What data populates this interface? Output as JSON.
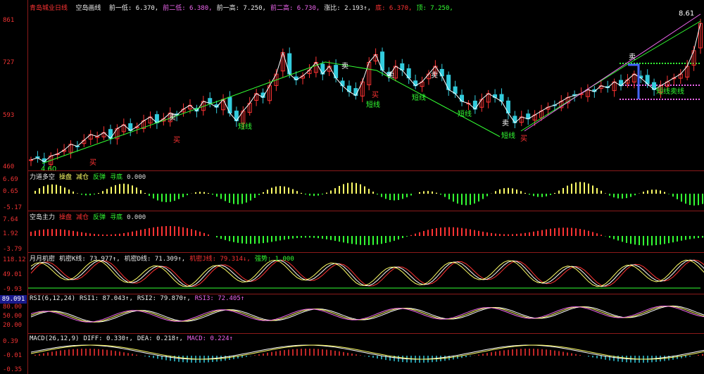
{
  "main": {
    "title": "青岛城业日线",
    "fields": [
      {
        "label": "空岛画线",
        "value": "",
        "color": "#eeeeee"
      },
      {
        "label": "前一低:",
        "value": "6.370,",
        "color": "#eeeeee"
      },
      {
        "label": "前二低:",
        "value": "6.380,",
        "color": "#ee66ee"
      },
      {
        "label": "前一高:",
        "value": "7.250,",
        "color": "#eeeeee"
      },
      {
        "label": "前二高:",
        "value": "6.730,",
        "color": "#ee66ee"
      },
      {
        "label": "涨比:",
        "value": "2.193↑,",
        "color": "#eeeeee"
      },
      {
        "label": "底:",
        "value": "6.370,",
        "color": "#ff3333"
      },
      {
        "label": "顶:",
        "value": "7.250,",
        "color": "#33ff33"
      }
    ],
    "yticks": [
      "861",
      "727",
      "593",
      "460"
    ],
    "marks": {
      "high_label": "8.61",
      "low_label": "4.60",
      "buy": "买",
      "sell": "卖",
      "short": "短线",
      "short_sell": "短线卖线"
    }
  },
  "panes": [
    {
      "title": "力道多空",
      "items": [
        {
          "t": "操盘",
          "c": "#ffff66"
        },
        {
          "t": "减仓",
          "c": "#ffff66"
        },
        {
          "t": "反弹",
          "c": "#33ff33"
        },
        {
          "t": "寻底",
          "c": "#33ff33"
        },
        {
          "t": "0.000",
          "c": "#dddddd"
        }
      ],
      "yticks": [
        "6.69",
        "0.65",
        "-5.17"
      ]
    },
    {
      "title": "空岛主力",
      "items": [
        {
          "t": "操盘",
          "c": "#ff3333"
        },
        {
          "t": "减仓",
          "c": "#ff3333"
        },
        {
          "t": "反弹",
          "c": "#33ff33"
        },
        {
          "t": "寻底",
          "c": "#33ff33"
        },
        {
          "t": "0.000",
          "c": "#dddddd"
        }
      ],
      "yticks": [
        "7.64",
        "1.92",
        "-3.79"
      ]
    },
    {
      "title": "月月机密",
      "items": [
        {
          "t": "机密K线: 73.977↑,",
          "c": "#eeeeee"
        },
        {
          "t": "机密D线: 71.309↑,",
          "c": "#eeeeee"
        },
        {
          "t": "机密J线: 79.314↓,",
          "c": "#ff3333"
        },
        {
          "t": "强势: 1.000",
          "c": "#33ff33"
        }
      ],
      "yticks": [
        "118.12",
        "49.01",
        "-9.93"
      ]
    },
    {
      "title": "RSI(6,12,24)",
      "items": [
        {
          "t": "RSI1: 87.043↑,",
          "c": "#eeeeee"
        },
        {
          "t": "RSI2: 79.870↑,",
          "c": "#eeeeee"
        },
        {
          "t": "RSI3: 72.405↑",
          "c": "#ee66ee"
        }
      ],
      "yticks": [
        "80.00",
        "50.00",
        "20.00"
      ],
      "cursor": "89.091"
    },
    {
      "title": "MACD(26,12,9)",
      "items": [
        {
          "t": "DIFF: 0.330↑,",
          "c": "#eeeeee"
        },
        {
          "t": "DEA: 0.218↑,",
          "c": "#eeeeee"
        },
        {
          "t": "MACD: 0.224↑",
          "c": "#ee66ee"
        }
      ],
      "yticks": [
        "0.39",
        "-0.01",
        "-0.35"
      ]
    }
  ],
  "colors": {
    "up": "#ff3333",
    "down": "#33ccdd",
    "grid": "#8b1a1a",
    "yellow": "#ffff66",
    "green": "#33ff33",
    "pink": "#ee66ee"
  },
  "chart_data": {
    "type": "candlestick",
    "y_range": [
      4.6,
      8.61
    ],
    "close_series": [
      4.8,
      4.85,
      4.75,
      4.9,
      4.95,
      5.05,
      5.2,
      5.15,
      5.3,
      5.45,
      5.4,
      5.5,
      5.35,
      5.6,
      5.7,
      5.55,
      5.65,
      5.8,
      5.9,
      5.75,
      5.85,
      6.0,
      5.95,
      6.1,
      6.2,
      6.05,
      6.3,
      6.25,
      6.15,
      6.35,
      6.0,
      5.8,
      6.05,
      6.25,
      6.5,
      6.4,
      6.7,
      7.0,
      7.55,
      7.0,
      6.85,
      6.95,
      7.1,
      7.3,
      7.0,
      7.2,
      6.9,
      6.7,
      6.55,
      6.45,
      6.8,
      7.3,
      7.5,
      7.1,
      6.95,
      7.2,
      7.1,
      6.9,
      6.7,
      6.8,
      7.0,
      7.2,
      6.95,
      6.6,
      6.5,
      6.3,
      6.25,
      6.1,
      6.35,
      6.5,
      6.4,
      6.3,
      6.0,
      5.75,
      5.9,
      5.85,
      5.95,
      6.05,
      6.15,
      6.2,
      6.3,
      6.4,
      6.45,
      6.5,
      6.6,
      6.55,
      6.7,
      6.65,
      6.8,
      6.7,
      6.85,
      7.0,
      6.9,
      6.75,
      6.6,
      6.7,
      6.8,
      6.9,
      7.0,
      7.2,
      7.6,
      8.3
    ]
  }
}
